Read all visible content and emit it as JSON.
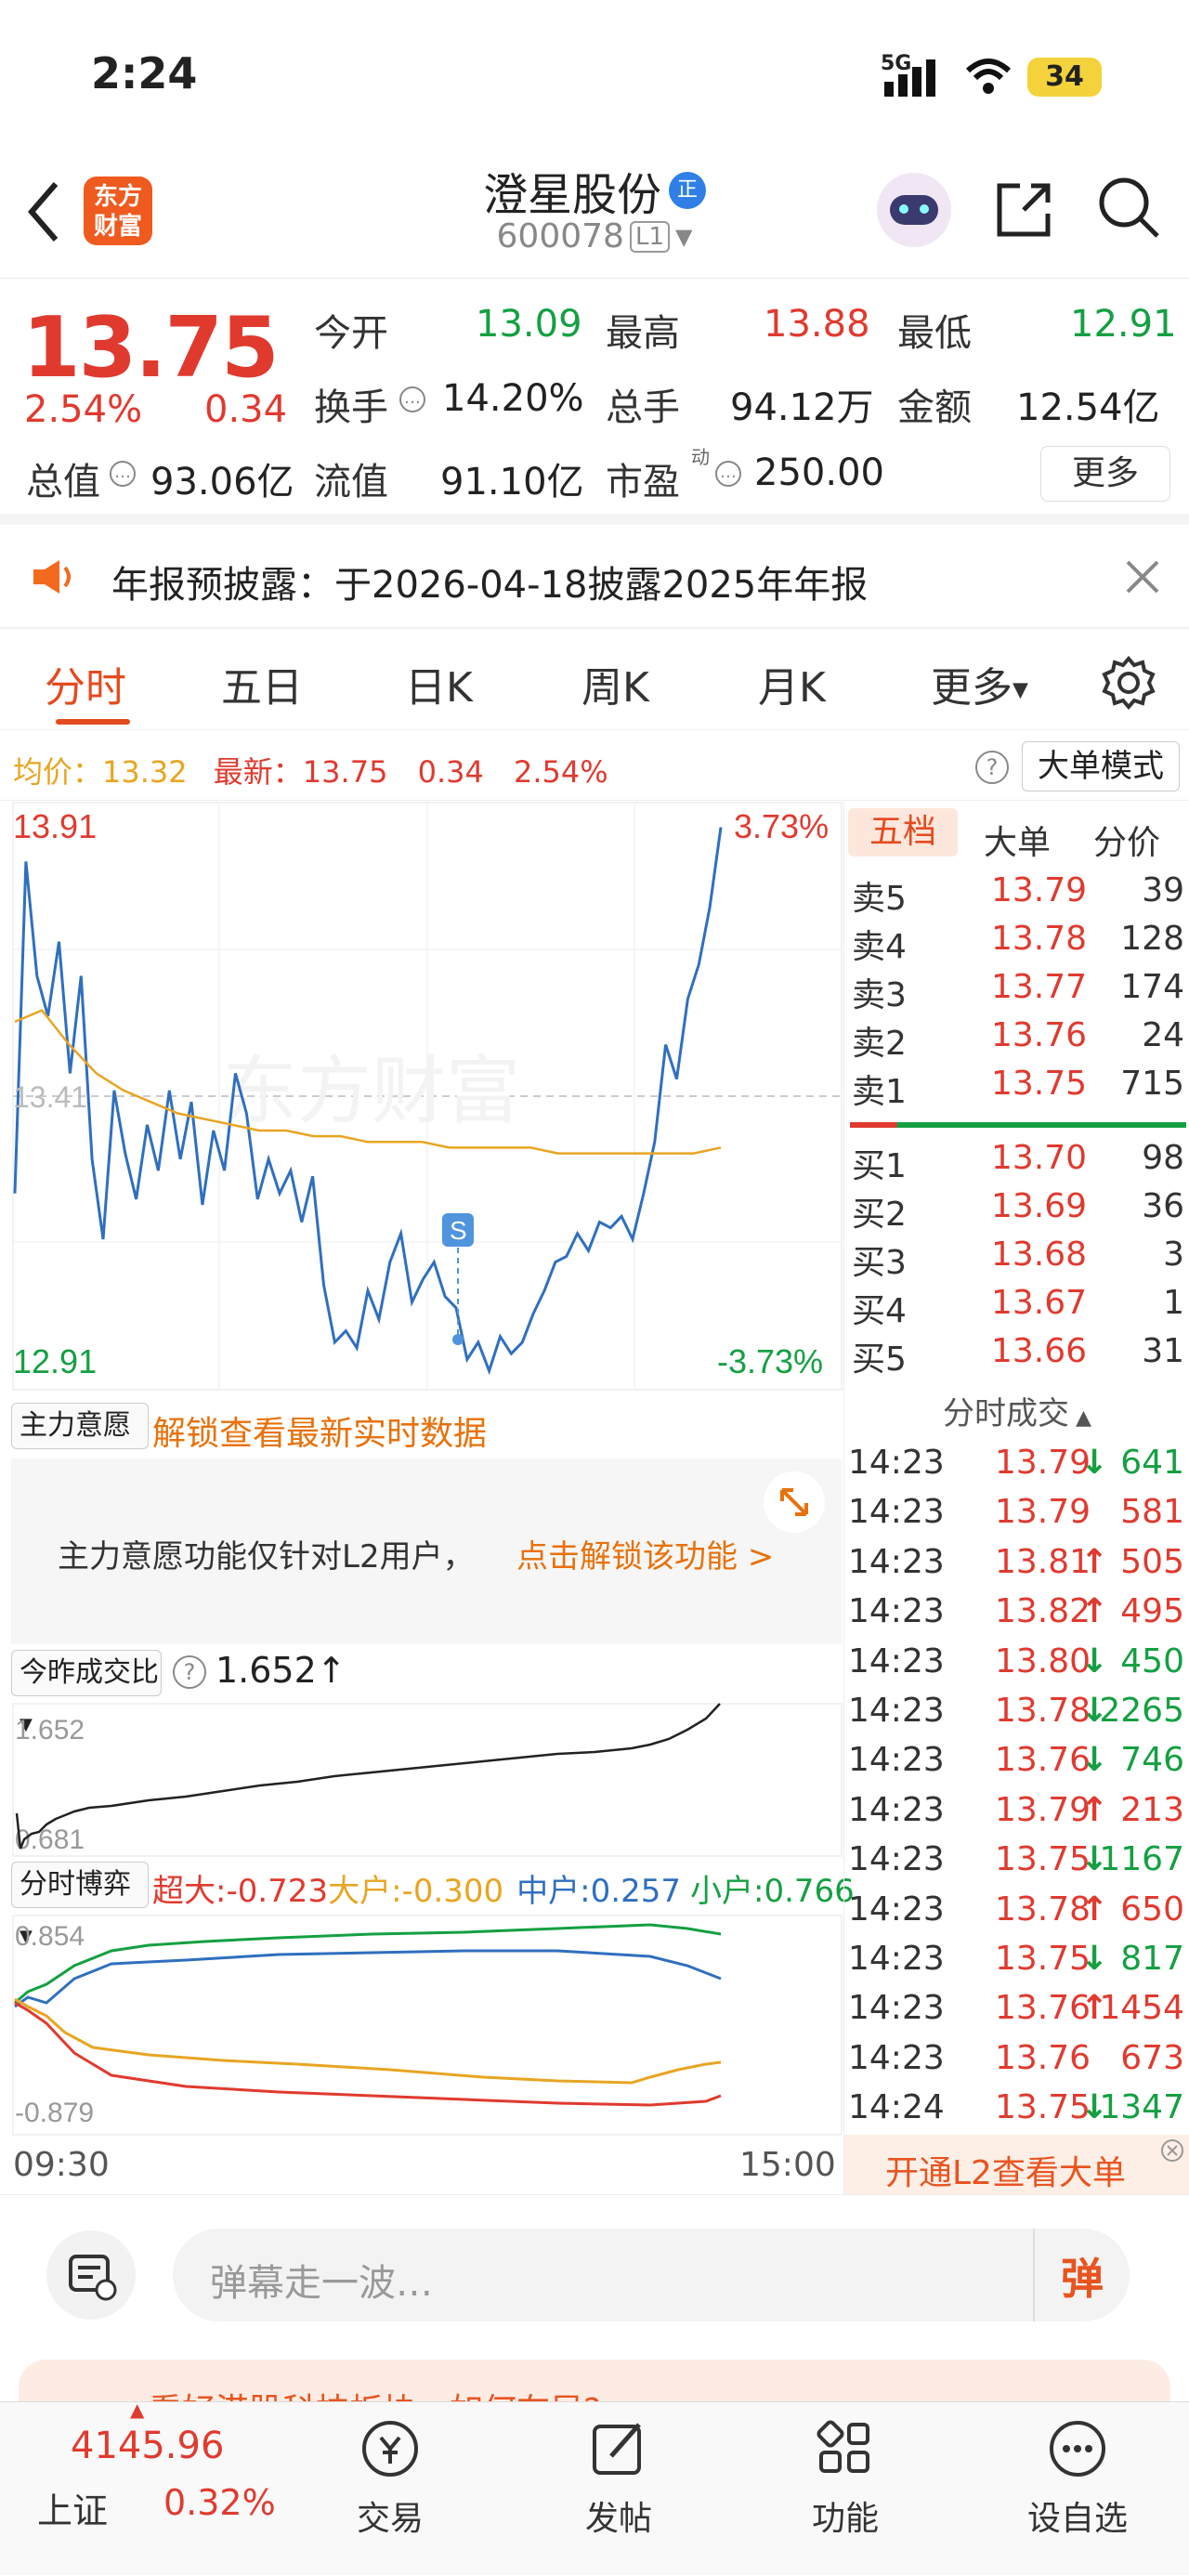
{
  "status_bar": {
    "time": "2:24",
    "network": "5G",
    "battery": "34"
  },
  "nav": {
    "stock_name": "澄星股份",
    "badge": "正",
    "stock_code": "600078",
    "level": "L1",
    "logo_line1": "东方",
    "logo_line2": "财富"
  },
  "quote": {
    "price": "13.75",
    "change_pct": "2.54%",
    "change": "0.34",
    "open_label": "今开",
    "open": "13.09",
    "high_label": "最高",
    "high": "13.88",
    "low_label": "最低",
    "low": "12.91",
    "turnover_label": "换手",
    "turnover": "14.20%",
    "volume_label": "总手",
    "volume": "94.12万",
    "amount_label": "金额",
    "amount": "12.54亿",
    "mcap_label": "总值",
    "mcap": "93.06亿",
    "float_label": "流值",
    "float": "91.10亿",
    "pe_label": "市盈",
    "pe_sup": "动",
    "pe": "250.00",
    "more_label": "更多"
  },
  "notice": {
    "text": "年报预披露：于2026-04-18披露2025年年报"
  },
  "tabs": [
    "分时",
    "五日",
    "日K",
    "周K",
    "月K",
    "更多"
  ],
  "avg_line": {
    "avg_label": "均价：",
    "avg": "13.32",
    "latest_label": "最新：",
    "latest": "13.75",
    "chg": "0.34",
    "pct": "2.54%",
    "mode_label": "大单模式"
  },
  "chart": {
    "top_price": "13.91",
    "bottom_price": "12.91",
    "mid_price": "13.41",
    "top_pct": "3.73%",
    "bottom_pct": "-3.73%",
    "watermark": "东方财富",
    "marker": "S",
    "start_time": "09:30",
    "end_time": "15:00"
  },
  "chart_data": {
    "type": "line",
    "title": "",
    "ylim": [
      12.91,
      13.91
    ],
    "series": [
      {
        "name": "",
        "values": [
          13.24,
          13.82,
          13.62,
          13.55,
          13.68,
          13.45,
          13.62,
          13.3,
          13.16,
          13.42,
          13.31,
          13.23,
          13.36,
          13.28,
          13.42,
          13.3,
          13.4,
          13.22,
          13.35,
          13.28,
          13.45,
          13.38,
          13.23,
          13.3,
          13.24,
          13.28,
          13.19,
          13.27,
          13.08,
          12.98,
          13.0,
          12.97,
          13.07,
          13.02,
          13.12,
          13.17,
          13.05,
          13.09,
          13.12,
          13.06,
          13.04,
          12.95,
          12.98,
          12.93,
          12.99,
          12.96,
          12.98,
          13.03,
          13.07,
          13.12,
          13.13,
          13.17,
          13.14,
          13.19,
          13.18,
          13.2,
          13.16,
          13.24,
          13.33,
          13.5,
          13.44,
          13.58,
          13.64,
          13.74,
          13.88
        ]
      },
      {
        "name": "均价",
        "values": [
          13.54,
          13.56,
          13.5,
          13.45,
          13.42,
          13.4,
          13.38,
          13.37,
          13.36,
          13.35,
          13.35,
          13.34,
          13.34,
          13.33,
          13.33,
          13.33,
          13.32,
          13.32,
          13.32,
          13.32,
          13.31,
          13.31,
          13.31,
          13.31,
          13.31,
          13.31,
          13.32
        ]
      }
    ]
  },
  "main_intent": {
    "label": "主力意愿",
    "lock_text": "解锁查看最新实时数据",
    "desc": "主力意愿功能仅针对L2用户，",
    "unlock_link": "点击解锁该功能 >"
  },
  "vol_ratio": {
    "label": "今昨成交比",
    "value": "1.652",
    "arrow": "↑",
    "top": "1.652",
    "bottom": "0.681"
  },
  "game": {
    "label": "分时博弈",
    "super_label": "超大:",
    "super": "-0.723",
    "big_label": "大户:",
    "big": "-0.300",
    "mid_label": "中户:",
    "mid": "0.257",
    "small_label": "小户:",
    "small": "0.766",
    "top": "0.854",
    "bottom": "-0.879"
  },
  "orderbook": {
    "tabs": [
      "五档",
      "大单",
      "分价"
    ],
    "asks": [
      {
        "label": "卖5",
        "price": "13.79",
        "vol": "39"
      },
      {
        "label": "卖4",
        "price": "13.78",
        "vol": "128"
      },
      {
        "label": "卖3",
        "price": "13.77",
        "vol": "174"
      },
      {
        "label": "卖2",
        "price": "13.76",
        "vol": "24"
      },
      {
        "label": "卖1",
        "price": "13.75",
        "vol": "715"
      }
    ],
    "bids": [
      {
        "label": "买1",
        "price": "13.70",
        "vol": "98"
      },
      {
        "label": "买2",
        "price": "13.69",
        "vol": "36"
      },
      {
        "label": "买3",
        "price": "13.68",
        "vol": "3"
      },
      {
        "label": "买4",
        "price": "13.67",
        "vol": "1"
      },
      {
        "label": "买5",
        "price": "13.66",
        "vol": "31"
      }
    ]
  },
  "ticks": {
    "title": "分时成交",
    "rows": [
      {
        "time": "14:23",
        "price": "13.79",
        "dir": "↓",
        "vol": "641"
      },
      {
        "time": "14:23",
        "price": "13.79",
        "dir": "",
        "vol": "581"
      },
      {
        "time": "14:23",
        "price": "13.81",
        "dir": "↑",
        "vol": "505"
      },
      {
        "time": "14:23",
        "price": "13.82",
        "dir": "↑",
        "vol": "495"
      },
      {
        "time": "14:23",
        "price": "13.80",
        "dir": "↓",
        "vol": "450"
      },
      {
        "time": "14:23",
        "price": "13.78",
        "dir": "↓",
        "vol": "2265"
      },
      {
        "time": "14:23",
        "price": "13.76",
        "dir": "↓",
        "vol": "746"
      },
      {
        "time": "14:23",
        "price": "13.79",
        "dir": "↑",
        "vol": "213"
      },
      {
        "time": "14:23",
        "price": "13.75",
        "dir": "↓",
        "vol": "1167"
      },
      {
        "time": "14:23",
        "price": "13.78",
        "dir": "↑",
        "vol": "650"
      },
      {
        "time": "14:23",
        "price": "13.75",
        "dir": "↓",
        "vol": "817"
      },
      {
        "time": "14:23",
        "price": "13.76",
        "dir": "↑",
        "vol": "1454"
      },
      {
        "time": "14:23",
        "price": "13.76",
        "dir": "",
        "vol": "673"
      },
      {
        "time": "14:24",
        "price": "13.75",
        "dir": "↓",
        "vol": "1347"
      }
    ],
    "l2_promo": "开通L2查看大单"
  },
  "comment": {
    "placeholder": "弹幕走一波…",
    "danmu_btn": "弹"
  },
  "banner": {
    "text": "看好港股科技板块，如何布局?"
  },
  "bottom_bar": {
    "index_value": "4145.96",
    "index_name": "上证",
    "index_pct": "0.32%",
    "items": [
      "交易",
      "发帖",
      "功能",
      "设自选"
    ]
  }
}
